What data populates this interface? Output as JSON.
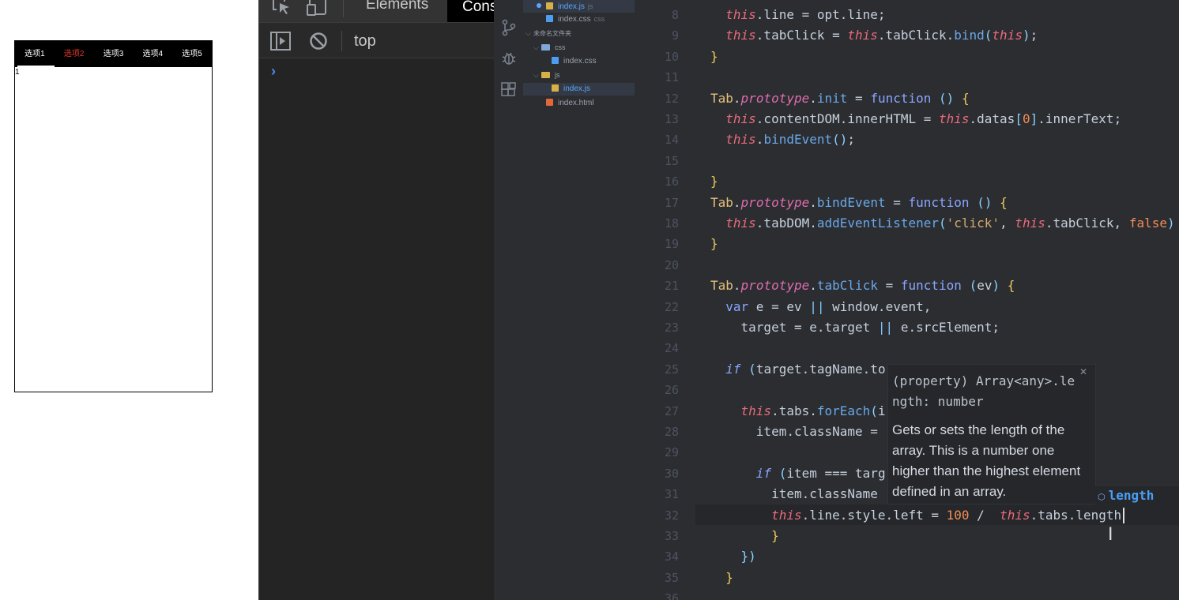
{
  "preview": {
    "tabs": [
      "选项1",
      "选项2",
      "选项3",
      "选项4",
      "选项5"
    ],
    "active_tab_index": 1,
    "content": "1"
  },
  "devtools": {
    "tabs": {
      "elements": "Elements",
      "console": "Cons"
    },
    "context": "top"
  },
  "explorer": {
    "open_file_name": "index.js",
    "open_file_type": "js",
    "open_file2_name": "index.css",
    "open_file2_type": "css",
    "folder_name": "未命名文件夹",
    "css_folder": "css",
    "css_file": "index.css",
    "js_folder": "js",
    "js_file": "index.js",
    "html_file": "index.html"
  },
  "code": {
    "line_numbers": [
      "8",
      "9",
      "10",
      "11",
      "12",
      "13",
      "14",
      "15",
      "16",
      "17",
      "18",
      "19",
      "20",
      "21",
      "22",
      "23",
      "24",
      "25",
      "26",
      "27",
      "28",
      "29",
      "30",
      "31",
      "32",
      "33",
      "34",
      "35",
      "36"
    ]
  },
  "hover": {
    "signature": "(property) Array<any>.length: number",
    "doc": "Gets or sets the length of the array. This is a number one higher than the highest element defined in an array.",
    "suggestion": "length"
  },
  "colors": {
    "active_tab": "#e83b2a",
    "tab_bar": "#000000",
    "editor_bg": "#2b2d31"
  }
}
